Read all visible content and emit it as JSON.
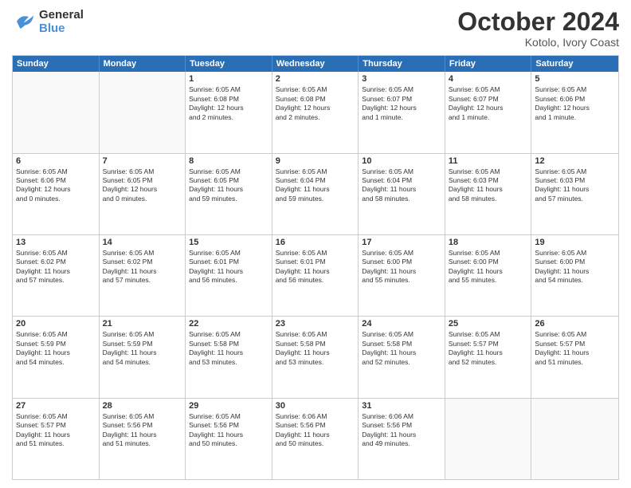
{
  "header": {
    "logo_line1": "General",
    "logo_line2": "Blue",
    "month": "October 2024",
    "location": "Kotolo, Ivory Coast"
  },
  "days": [
    "Sunday",
    "Monday",
    "Tuesday",
    "Wednesday",
    "Thursday",
    "Friday",
    "Saturday"
  ],
  "rows": [
    [
      {
        "day": "",
        "empty": true
      },
      {
        "day": "",
        "empty": true
      },
      {
        "day": "1",
        "text": "Sunrise: 6:05 AM\nSunset: 6:08 PM\nDaylight: 12 hours\nand 2 minutes."
      },
      {
        "day": "2",
        "text": "Sunrise: 6:05 AM\nSunset: 6:08 PM\nDaylight: 12 hours\nand 2 minutes."
      },
      {
        "day": "3",
        "text": "Sunrise: 6:05 AM\nSunset: 6:07 PM\nDaylight: 12 hours\nand 1 minute."
      },
      {
        "day": "4",
        "text": "Sunrise: 6:05 AM\nSunset: 6:07 PM\nDaylight: 12 hours\nand 1 minute."
      },
      {
        "day": "5",
        "text": "Sunrise: 6:05 AM\nSunset: 6:06 PM\nDaylight: 12 hours\nand 1 minute."
      }
    ],
    [
      {
        "day": "6",
        "text": "Sunrise: 6:05 AM\nSunset: 6:06 PM\nDaylight: 12 hours\nand 0 minutes."
      },
      {
        "day": "7",
        "text": "Sunrise: 6:05 AM\nSunset: 6:05 PM\nDaylight: 12 hours\nand 0 minutes."
      },
      {
        "day": "8",
        "text": "Sunrise: 6:05 AM\nSunset: 6:05 PM\nDaylight: 11 hours\nand 59 minutes."
      },
      {
        "day": "9",
        "text": "Sunrise: 6:05 AM\nSunset: 6:04 PM\nDaylight: 11 hours\nand 59 minutes."
      },
      {
        "day": "10",
        "text": "Sunrise: 6:05 AM\nSunset: 6:04 PM\nDaylight: 11 hours\nand 58 minutes."
      },
      {
        "day": "11",
        "text": "Sunrise: 6:05 AM\nSunset: 6:03 PM\nDaylight: 11 hours\nand 58 minutes."
      },
      {
        "day": "12",
        "text": "Sunrise: 6:05 AM\nSunset: 6:03 PM\nDaylight: 11 hours\nand 57 minutes."
      }
    ],
    [
      {
        "day": "13",
        "text": "Sunrise: 6:05 AM\nSunset: 6:02 PM\nDaylight: 11 hours\nand 57 minutes."
      },
      {
        "day": "14",
        "text": "Sunrise: 6:05 AM\nSunset: 6:02 PM\nDaylight: 11 hours\nand 57 minutes."
      },
      {
        "day": "15",
        "text": "Sunrise: 6:05 AM\nSunset: 6:01 PM\nDaylight: 11 hours\nand 56 minutes."
      },
      {
        "day": "16",
        "text": "Sunrise: 6:05 AM\nSunset: 6:01 PM\nDaylight: 11 hours\nand 56 minutes."
      },
      {
        "day": "17",
        "text": "Sunrise: 6:05 AM\nSunset: 6:00 PM\nDaylight: 11 hours\nand 55 minutes."
      },
      {
        "day": "18",
        "text": "Sunrise: 6:05 AM\nSunset: 6:00 PM\nDaylight: 11 hours\nand 55 minutes."
      },
      {
        "day": "19",
        "text": "Sunrise: 6:05 AM\nSunset: 6:00 PM\nDaylight: 11 hours\nand 54 minutes."
      }
    ],
    [
      {
        "day": "20",
        "text": "Sunrise: 6:05 AM\nSunset: 5:59 PM\nDaylight: 11 hours\nand 54 minutes."
      },
      {
        "day": "21",
        "text": "Sunrise: 6:05 AM\nSunset: 5:59 PM\nDaylight: 11 hours\nand 54 minutes."
      },
      {
        "day": "22",
        "text": "Sunrise: 6:05 AM\nSunset: 5:58 PM\nDaylight: 11 hours\nand 53 minutes."
      },
      {
        "day": "23",
        "text": "Sunrise: 6:05 AM\nSunset: 5:58 PM\nDaylight: 11 hours\nand 53 minutes."
      },
      {
        "day": "24",
        "text": "Sunrise: 6:05 AM\nSunset: 5:58 PM\nDaylight: 11 hours\nand 52 minutes."
      },
      {
        "day": "25",
        "text": "Sunrise: 6:05 AM\nSunset: 5:57 PM\nDaylight: 11 hours\nand 52 minutes."
      },
      {
        "day": "26",
        "text": "Sunrise: 6:05 AM\nSunset: 5:57 PM\nDaylight: 11 hours\nand 51 minutes."
      }
    ],
    [
      {
        "day": "27",
        "text": "Sunrise: 6:05 AM\nSunset: 5:57 PM\nDaylight: 11 hours\nand 51 minutes."
      },
      {
        "day": "28",
        "text": "Sunrise: 6:05 AM\nSunset: 5:56 PM\nDaylight: 11 hours\nand 51 minutes."
      },
      {
        "day": "29",
        "text": "Sunrise: 6:05 AM\nSunset: 5:56 PM\nDaylight: 11 hours\nand 50 minutes."
      },
      {
        "day": "30",
        "text": "Sunrise: 6:06 AM\nSunset: 5:56 PM\nDaylight: 11 hours\nand 50 minutes."
      },
      {
        "day": "31",
        "text": "Sunrise: 6:06 AM\nSunset: 5:56 PM\nDaylight: 11 hours\nand 49 minutes."
      },
      {
        "day": "",
        "empty": true
      },
      {
        "day": "",
        "empty": true
      }
    ]
  ]
}
